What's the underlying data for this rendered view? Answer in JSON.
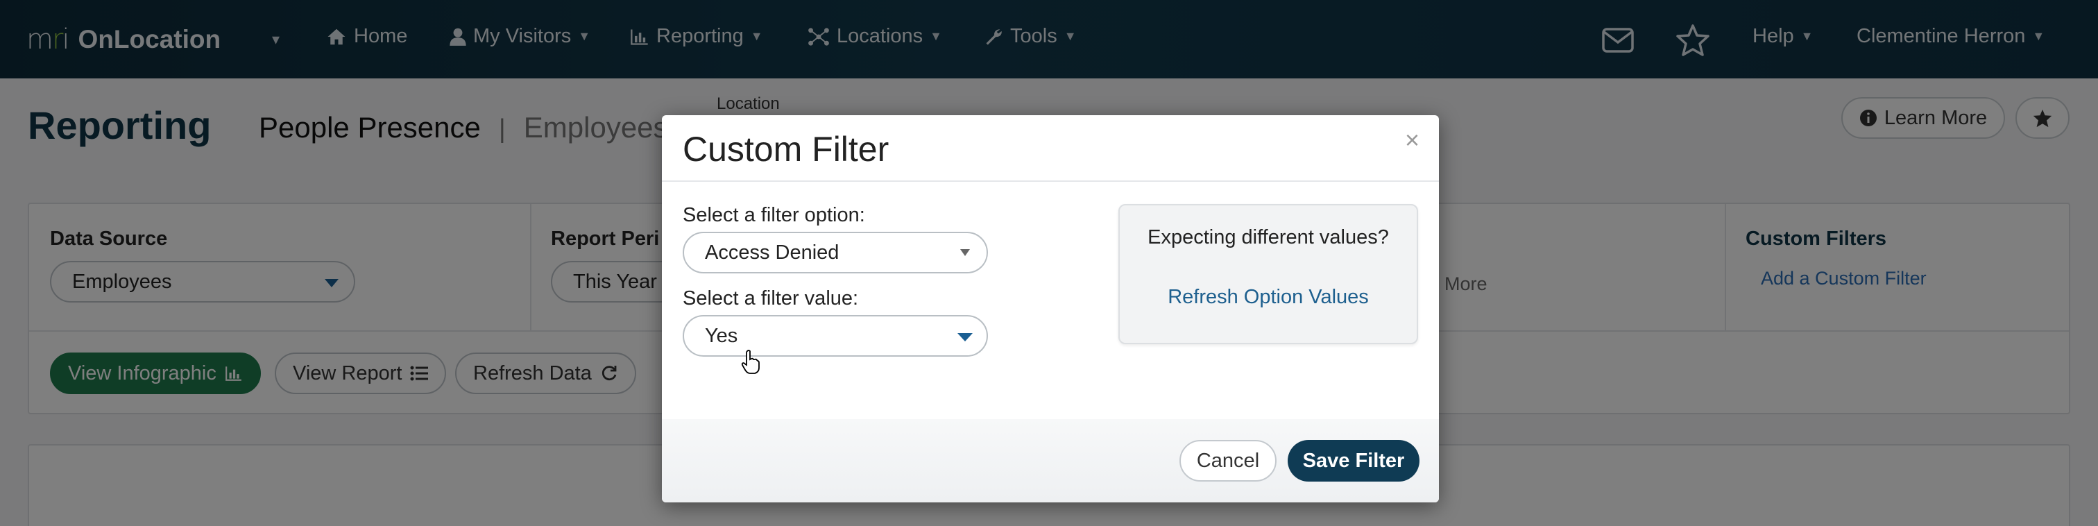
{
  "navbar": {
    "brand_logo": "mri",
    "brand_name": "OnLocation",
    "items": [
      {
        "label": "Home",
        "icon": "home-icon"
      },
      {
        "label": "My Visitors",
        "icon": "user-icon"
      },
      {
        "label": "Reporting",
        "icon": "bar-chart-icon"
      },
      {
        "label": "Locations",
        "icon": "network-icon"
      },
      {
        "label": "Tools",
        "icon": "wrench-icon"
      }
    ],
    "help_label": "Help",
    "user_name": "Clementine Herron"
  },
  "page": {
    "title": "Reporting",
    "tab_active": "People Presence",
    "tab_separator": "|",
    "tab_other": "Employees",
    "location_label": "Location",
    "learn_more_label": "Learn More"
  },
  "filters": {
    "data_source_label": "Data Source",
    "data_source_value": "Employees",
    "report_period_label": "Report Peri",
    "report_period_value": "This Year",
    "more_link": "More",
    "custom_filters_label": "Custom Filters",
    "add_custom_filter": "Add a Custom Filter"
  },
  "actions": {
    "view_infographic": "View Infographic",
    "view_report": "View Report",
    "refresh_data": "Refresh Data"
  },
  "modal": {
    "title": "Custom Filter",
    "close_glyph": "×",
    "filter_option_label": "Select a filter option:",
    "filter_option_value": "Access Denied",
    "filter_value_label": "Select a filter value:",
    "filter_value_value": "Yes",
    "expecting_text": "Expecting different values?",
    "refresh_link": "Refresh Option Values",
    "cancel_label": "Cancel",
    "save_label": "Save Filter"
  },
  "colors": {
    "navbar": "#0f3143",
    "primary_green": "#1e7a4c",
    "save_button": "#0f3b54",
    "link_blue": "#1d5f8e"
  }
}
